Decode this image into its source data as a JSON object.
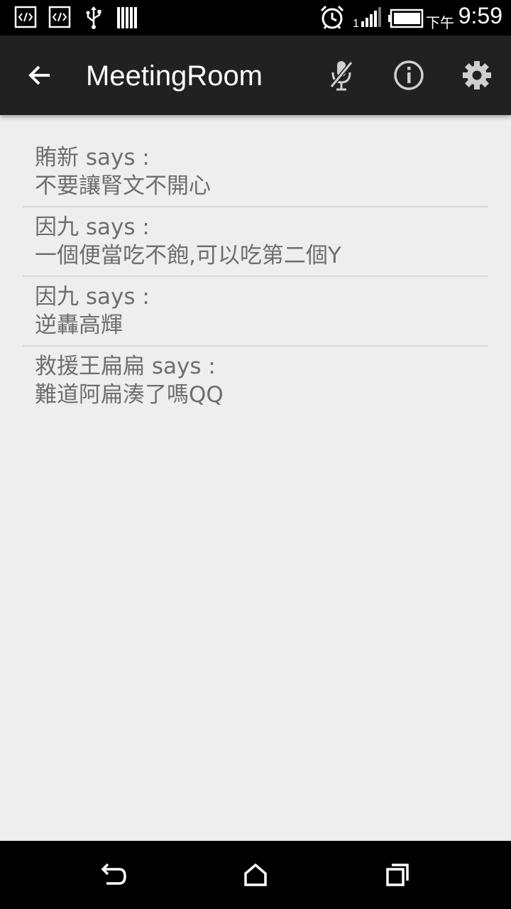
{
  "status_bar": {
    "icons_left": [
      "code-icon",
      "code-icon",
      "usb-icon",
      "barcode-icon"
    ],
    "icons_right": [
      "alarm-icon",
      "signal-icon",
      "battery-icon"
    ],
    "signal_label": "1",
    "ampm": "下午",
    "time": "9:59"
  },
  "app_bar": {
    "title": "MeetingRoom",
    "actions": [
      "mic-off-icon",
      "info-icon",
      "settings-icon"
    ]
  },
  "messages": [
    {
      "sender": "賄新 says :",
      "text": "不要讓腎文不開心"
    },
    {
      "sender": "因九 says :",
      "text": "一個便當吃不飽,可以吃第二個Y"
    },
    {
      "sender": "因九 says :",
      "text": "逆轟高輝"
    },
    {
      "sender": "救援王扁扁 says :",
      "text": "難道阿扁湊了嗎QQ"
    }
  ],
  "nav_bar": {
    "buttons": [
      "back-icon",
      "home-icon",
      "recents-icon"
    ]
  },
  "colors": {
    "status_bar": "#000000",
    "app_bar": "#212121",
    "background": "#eeeeee",
    "message_text": "#6e6e6e",
    "divider": "#d6d6d6"
  }
}
